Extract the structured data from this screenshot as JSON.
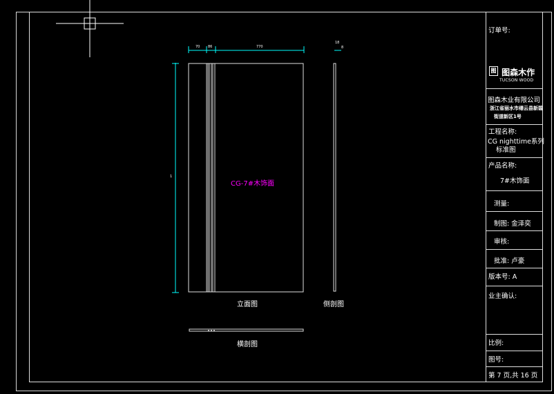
{
  "colors": {
    "line": "#e0e0e0",
    "dim": "#00ffff",
    "accent": "#ff00ff",
    "bg": "#000000"
  },
  "title_block": {
    "order_no": "订单号:",
    "logo_mark": "图",
    "logo_cn": "图森木作",
    "logo_en": "TUCSON WOOD",
    "company": "图森木业有限公司",
    "address_line1": "浙江省丽水市缙云县新碧",
    "address_line2": "街道新区1号",
    "project_label": "工程名称:",
    "project_line1": "CG nighttime系列",
    "project_line2": "标准图",
    "product_label": "产品名称:",
    "product_value": "7#木饰面",
    "measure": "测量:",
    "drawn_by": "制图: 金泽奕",
    "review": "审核:",
    "approve": "批准: 卢豪",
    "version": "版本号:   A",
    "owner_confirm": "业主确认:",
    "scale": "比例:",
    "drawing_no": "图号:",
    "page": "第 7 页,共 16 页"
  },
  "drawing": {
    "part_label": "CG-7#木饰面",
    "elevation_label": "立面图",
    "side_label": "侧剖图",
    "cross_label": "横剖图",
    "dim_a": "70",
    "dim_b": "86",
    "dim_c": "770",
    "side_dim_a": "18",
    "side_dim_b": "8",
    "height_dim": "1"
  }
}
